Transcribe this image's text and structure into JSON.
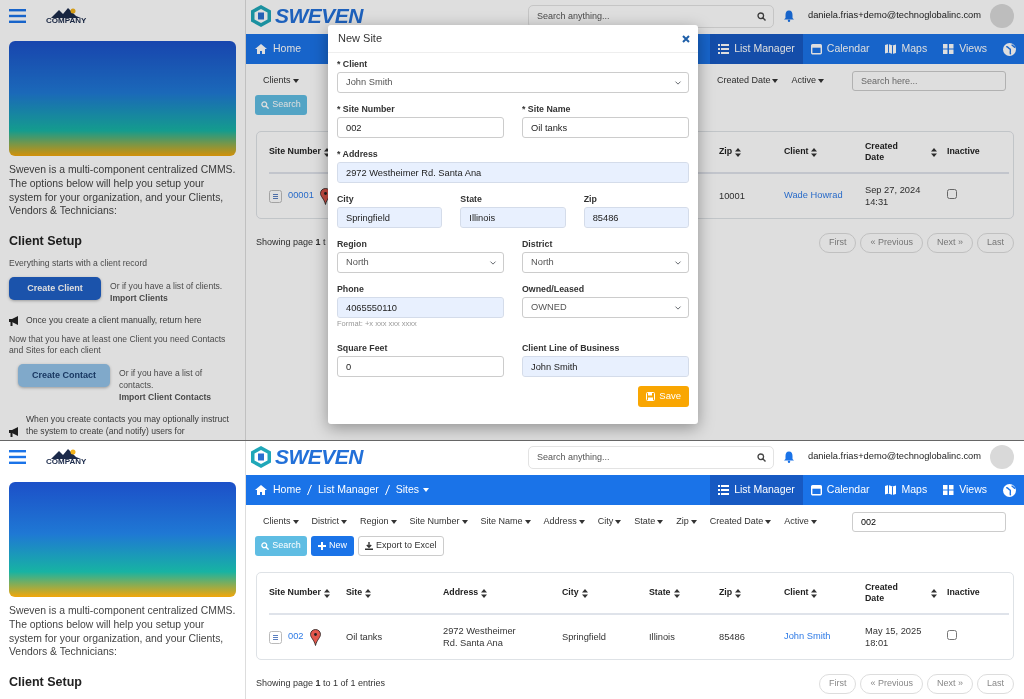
{
  "screens": [
    {
      "sidebar": {
        "logo": "COMPANY",
        "intro": "Sweven is a multi-component centralized CMMS. The options below will help you setup your system for your organization, and your Clients,\nVendors & Technicians:",
        "heading": "Client Setup",
        "steps": [
          {
            "kind": "text",
            "text": "Everything starts with a client record"
          },
          {
            "kind": "primary",
            "button": "Create Client",
            "note": "Or if you have a list of clients.",
            "link": "Import Clients"
          },
          {
            "kind": "notice",
            "text": "Once you create a client manually, return here"
          },
          {
            "kind": "text",
            "text": "Now that you have at least one Client you need Contacts and Sites for  each client"
          },
          {
            "kind": "secondary",
            "button": "Create Contact",
            "note": "Or if you have a list of contacts.",
            "link": "Import Client Contacts"
          },
          {
            "kind": "notice",
            "text": "When you create contacts you may optionally instruct the system to create (and notify) users for"
          }
        ]
      },
      "header": {
        "logo": "SWEVEN",
        "search_placeholder": "Search anything...",
        "user": "daniela.frias+demo@technoglobalinc.com"
      },
      "nav": {
        "breadcrumb": [
          {
            "label": "Home",
            "dropdown": false
          }
        ],
        "tabs": [
          {
            "label": "List Manager",
            "selected": true
          },
          {
            "label": "Calendar",
            "selected": false
          },
          {
            "label": "Maps",
            "selected": false
          },
          {
            "label": "Views",
            "selected": false
          },
          {
            "selected": false
          }
        ]
      },
      "filters": {
        "groups": [
          [
            "Clients"
          ],
          [
            "Created Date",
            "Active"
          ]
        ],
        "search": {
          "placeholder": "Search here..."
        }
      },
      "actions": [
        {
          "kind": "search",
          "label": "Search"
        }
      ],
      "table": {
        "columns": [
          {
            "label": "Site Number",
            "sortable": true
          },
          {
            "label": "Zip",
            "sortable": true
          },
          {
            "label": "Client",
            "sortable": true
          },
          {
            "label": "Created Date",
            "sortable": true
          },
          {
            "label": "Inactive",
            "sortable": false
          }
        ],
        "rows": [
          {
            "cells": [
              {
                "kind": "site",
                "text": "00001"
              },
              {
                "kind": "text",
                "text": "10001"
              },
              {
                "kind": "link",
                "text": "Wade Howrad"
              },
              {
                "kind": "text",
                "text": "Sep 27, 2024 14:31"
              },
              {
                "kind": "checkbox",
                "checked": false
              }
            ]
          }
        ]
      },
      "footer": {
        "summary": "Showing page **1** t",
        "pages": [
          {
            "label": "First",
            "disabled": true
          },
          {
            "label": "« Previous",
            "disabled": true
          },
          {
            "label": "Next »",
            "disabled": true
          },
          {
            "label": "Last",
            "disabled": true
          }
        ]
      },
      "modal": {
        "title": "New Site",
        "rows": [
          [
            {
              "label": "* Client",
              "kind": "select",
              "value": "John Smith",
              "highlighted": false
            }
          ],
          [
            {
              "label": "* Site Number",
              "kind": "input",
              "value": "002",
              "highlighted": false
            },
            {
              "label": "* Site Name",
              "kind": "input",
              "value": "Oil tanks",
              "highlighted": false
            }
          ],
          [
            {
              "label": "* Address",
              "kind": "input",
              "value": "2972 Westheimer Rd. Santa Ana",
              "highlighted": true
            }
          ],
          [
            {
              "label": "City",
              "kind": "input",
              "value": "Springfield",
              "highlighted": true
            },
            {
              "label": "State",
              "kind": "input",
              "value": "Illinois",
              "highlighted": true
            },
            {
              "label": "Zip",
              "kind": "input",
              "value": "85486",
              "highlighted": true
            }
          ],
          [
            {
              "label": "Region",
              "kind": "select",
              "value": "North",
              "highlighted": false
            },
            {
              "label": "District",
              "kind": "select",
              "value": "North",
              "highlighted": false
            }
          ],
          [
            {
              "label": "Phone",
              "kind": "input",
              "value": "4065550110",
              "highlighted": true,
              "help": "Format: +x xxx xxx xxxx"
            },
            {
              "label": "Owned/Leased",
              "kind": "select",
              "value": "OWNED",
              "highlighted": false
            }
          ],
          [
            {
              "label": "Square Feet",
              "kind": "input",
              "value": "0",
              "highlighted": false
            },
            {
              "label": "Client Line of Business",
              "kind": "input",
              "value": "John Smith",
              "highlighted": true
            }
          ]
        ],
        "save": "Save"
      }
    },
    {
      "sidebar": {
        "logo": "COMPANY",
        "intro": "Sweven is a multi-component centralized CMMS. The options below will help you setup your system for your organization, and your Clients,\nVendors & Technicians:",
        "heading": "Client Setup"
      },
      "header": {
        "logo": "SWEVEN",
        "search_placeholder": "Search anything...",
        "user": "daniela.frias+demo@technoglobalinc.com"
      },
      "nav": {
        "breadcrumb": [
          {
            "label": "Home",
            "dropdown": false
          },
          {
            "label": "List Manager",
            "dropdown": false
          },
          {
            "label": "Sites",
            "dropdown": true
          }
        ],
        "tabs": [
          {
            "label": "List Manager",
            "selected": true
          },
          {
            "label": "Calendar",
            "selected": false
          },
          {
            "label": "Maps",
            "selected": false
          },
          {
            "label": "Views",
            "selected": false
          },
          {
            "selected": false
          }
        ]
      },
      "filters": {
        "groups": [
          [
            "Clients",
            "District",
            "Region",
            "Site Number",
            "Site Name",
            "Address",
            "City",
            "State",
            "Zip",
            "Created Date",
            "Active"
          ]
        ],
        "search": {
          "value": "002"
        }
      },
      "actions": [
        {
          "kind": "search",
          "label": "Search"
        },
        {
          "kind": "new",
          "label": "New"
        },
        {
          "kind": "export",
          "label": "Export to Excel"
        }
      ],
      "table": {
        "columns": [
          {
            "label": "Site Number",
            "sortable": true
          },
          {
            "label": "Site",
            "sortable": true
          },
          {
            "label": "Address",
            "sortable": true
          },
          {
            "label": "City",
            "sortable": true
          },
          {
            "label": "State",
            "sortable": true
          },
          {
            "label": "Zip",
            "sortable": true
          },
          {
            "label": "Client",
            "sortable": true
          },
          {
            "label": "Created Date",
            "sortable": true
          },
          {
            "label": "Inactive",
            "sortable": false
          }
        ],
        "rows": [
          {
            "cells": [
              {
                "kind": "site",
                "text": "002"
              },
              {
                "kind": "text",
                "text": "Oil tanks"
              },
              {
                "kind": "text",
                "text": "2972 Westheimer Rd. Santa Ana"
              },
              {
                "kind": "text",
                "text": "Springfield"
              },
              {
                "kind": "text",
                "text": "Illinois"
              },
              {
                "kind": "text",
                "text": "85486"
              },
              {
                "kind": "link",
                "text": "John Smith"
              },
              {
                "kind": "text",
                "text": "May 15, 2025 18:01"
              },
              {
                "kind": "checkbox",
                "checked": false
              }
            ]
          }
        ]
      },
      "footer": {
        "summary": "Showing page **1** to 1 of 1 entries",
        "pages": [
          {
            "label": "First",
            "disabled": true
          },
          {
            "label": "« Previous",
            "disabled": true
          },
          {
            "label": "Next »",
            "disabled": true
          },
          {
            "label": "Last",
            "disabled": true
          }
        ]
      }
    }
  ]
}
